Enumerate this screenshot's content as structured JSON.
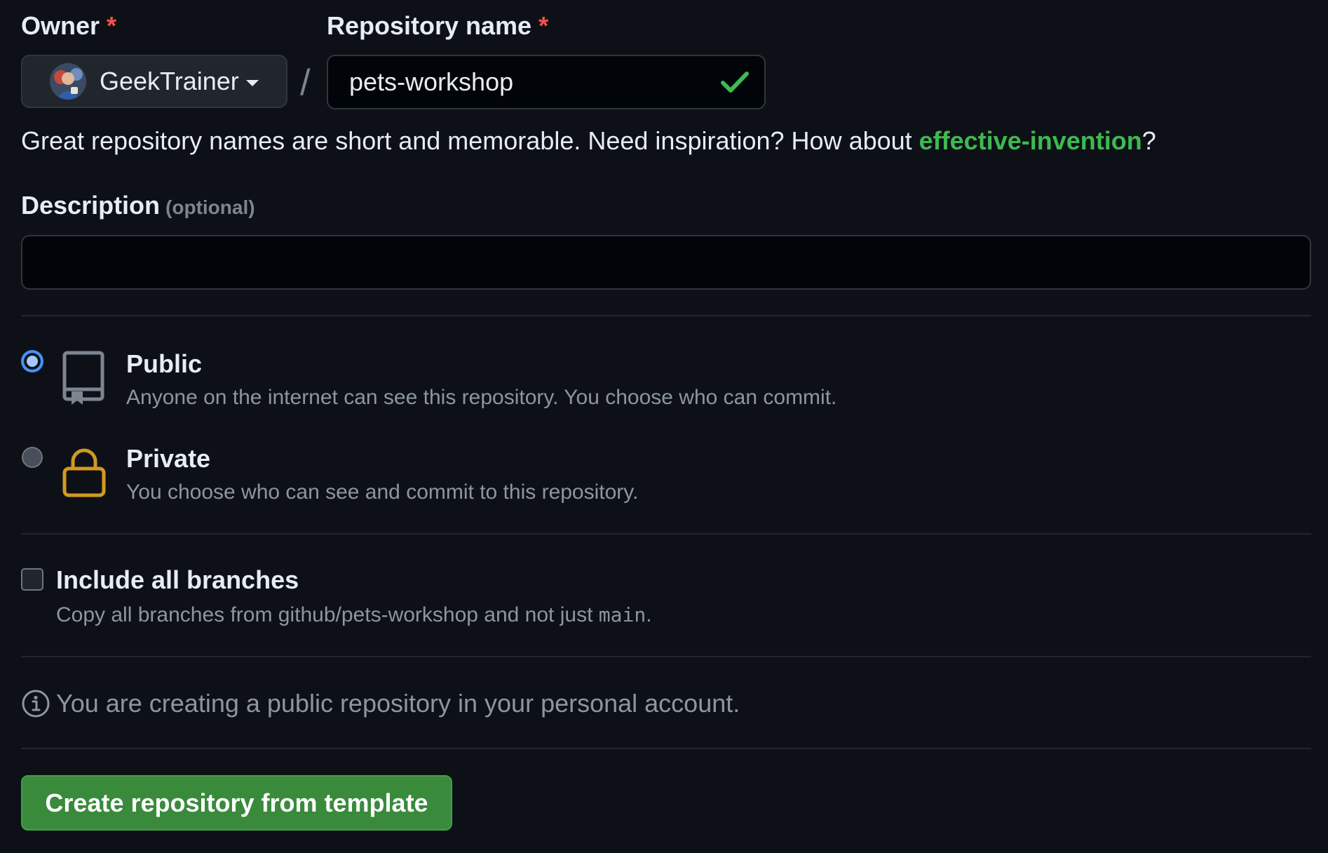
{
  "owner": {
    "label": "Owner",
    "required_mark": "*",
    "selected": "GeekTrainer"
  },
  "repository": {
    "label": "Repository name",
    "required_mark": "*",
    "value": "pets-workshop",
    "separator": "/"
  },
  "hint": {
    "text": "Great repository names are short and memorable. Need inspiration? How about ",
    "suggestion": "effective-invention",
    "suffix": "?"
  },
  "description": {
    "label": "Description",
    "optional": "(optional)",
    "value": ""
  },
  "visibility": {
    "public": {
      "title": "Public",
      "description": "Anyone on the internet can see this repository. You choose who can commit.",
      "checked": true,
      "icon": "repo-icon"
    },
    "private": {
      "title": "Private",
      "description": "You choose who can see and commit to this repository.",
      "checked": false,
      "icon": "lock-icon"
    }
  },
  "branches": {
    "title": "Include all branches",
    "description_prefix": "Copy all branches from github/pets-workshop and not just ",
    "branch_name": "main",
    "description_suffix": ".",
    "checked": false
  },
  "info": {
    "icon": "info-icon",
    "text": "You are creating a public repository in your personal account."
  },
  "submit": {
    "label": "Create repository from template"
  },
  "colors": {
    "background": "#0d1117",
    "accent_green": "#3fb950",
    "button_green": "#3a8a3c",
    "required_red": "#f85149",
    "lock_orange": "#d29922"
  }
}
